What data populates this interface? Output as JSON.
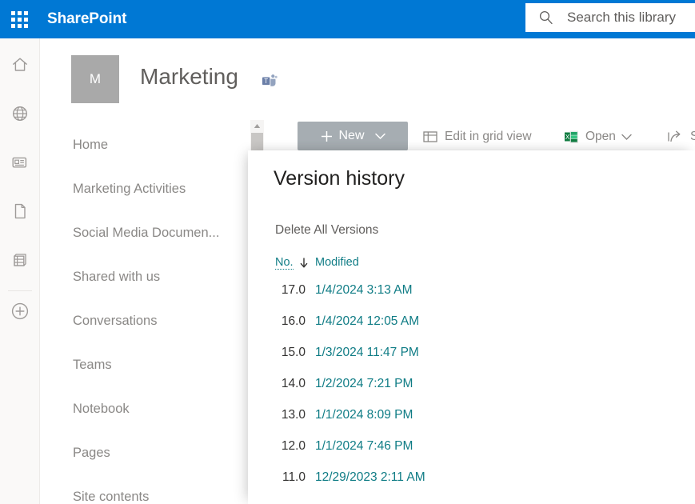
{
  "suite": {
    "waffle_icon": "app-launcher-waffle-icon",
    "brand": "SharePoint",
    "search": {
      "icon": "search-icon",
      "placeholder": "Search this library"
    },
    "brand_color": "#0078d4"
  },
  "app_rail": {
    "items": [
      {
        "icon": "home-icon",
        "name": "home"
      },
      {
        "icon": "globe-icon",
        "name": "global-navigation"
      },
      {
        "icon": "news-icon",
        "name": "news"
      },
      {
        "icon": "document-icon",
        "name": "files"
      },
      {
        "icon": "lists-icon",
        "name": "lists"
      },
      {
        "icon": "plus-circle-icon",
        "name": "create"
      }
    ]
  },
  "site_header": {
    "logo_initial": "M",
    "logo_color": "#a9a9a9",
    "title": "Marketing",
    "teams_icon": "microsoft-teams-icon"
  },
  "left_nav": {
    "items": [
      {
        "label": "Home"
      },
      {
        "label": "Marketing Activities"
      },
      {
        "label": "Social Media Documen..."
      },
      {
        "label": "Shared with us"
      },
      {
        "label": "Conversations"
      },
      {
        "label": "Teams"
      },
      {
        "label": "Notebook"
      },
      {
        "label": "Pages"
      },
      {
        "label": "Site contents"
      }
    ]
  },
  "command_bar": {
    "new_button": {
      "label": "New",
      "icon": "plus-icon",
      "chevron": "chevron-down-icon"
    },
    "buttons": [
      {
        "label": "Edit in grid view",
        "icon": "grid-view-icon"
      },
      {
        "label": "Open",
        "icon": "excel-icon",
        "chevron": "chevron-down-icon"
      },
      {
        "label": "Sh",
        "icon": "share-icon"
      }
    ]
  },
  "scrollbar": {
    "up_arrow_icon": "scroll-up-arrow-icon",
    "thumb": "scrollbar-thumb"
  },
  "panel": {
    "title": "Version history",
    "delete_all_label": "Delete All Versions",
    "table": {
      "columns": [
        {
          "label": "No.",
          "sorted": "descending",
          "sort_icon": "arrow-down-icon"
        },
        {
          "label": "Modified"
        }
      ],
      "rows": [
        {
          "no": "17.0",
          "modified": "1/4/2024 3:13 AM"
        },
        {
          "no": "16.0",
          "modified": "1/4/2024 12:05 AM"
        },
        {
          "no": "15.0",
          "modified": "1/3/2024 11:47 PM"
        },
        {
          "no": "14.0",
          "modified": "1/2/2024 7:21 PM"
        },
        {
          "no": "13.0",
          "modified": "1/1/2024 8:09 PM"
        },
        {
          "no": "12.0",
          "modified": "1/1/2024 7:46 PM"
        },
        {
          "no": "11.0",
          "modified": "12/29/2023 2:11 AM"
        }
      ]
    },
    "link_color": "#0f7c85"
  }
}
